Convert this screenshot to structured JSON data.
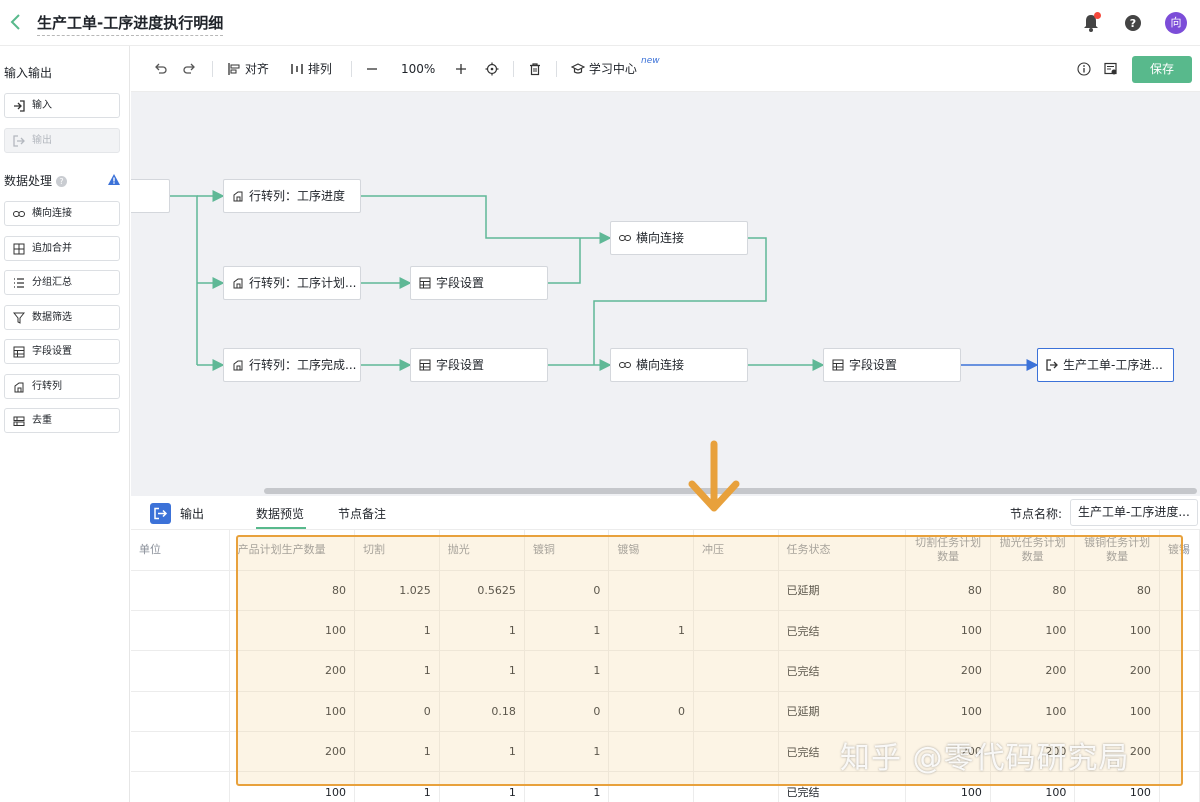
{
  "header": {
    "title": "生产工单-工序进度执行明细",
    "avatar_text": "向"
  },
  "sidebar": {
    "io_section": "输入输出",
    "io_items": [
      {
        "label": "输入",
        "icon": "input-icon"
      },
      {
        "label": "输出",
        "icon": "output-icon",
        "disabled": true
      }
    ],
    "proc_section": "数据处理",
    "proc_items": [
      {
        "label": "横向连接",
        "icon": "link-icon"
      },
      {
        "label": "追加合并",
        "icon": "merge-icon"
      },
      {
        "label": "分组汇总",
        "icon": "list-icon"
      },
      {
        "label": "数据筛选",
        "icon": "filter-icon"
      },
      {
        "label": "字段设置",
        "icon": "table-icon"
      },
      {
        "label": "行转列",
        "icon": "pivot-icon"
      },
      {
        "label": "去重",
        "icon": "dedupe-icon"
      }
    ]
  },
  "toolbar": {
    "align": "对齐",
    "arrange": "排列",
    "zoom": "100%",
    "learn": "学习中心",
    "new_badge": "new",
    "save": "保存"
  },
  "flow": {
    "nodes": {
      "n1": "行转列：工序进度",
      "n2": "行转列：工序计划...",
      "n3": "行转列：工序完成...",
      "n4": "字段设置",
      "n5": "字段设置",
      "n6": "横向连接",
      "n7": "横向连接",
      "n8": "字段设置",
      "n9": "生产工单-工序进..."
    }
  },
  "panel": {
    "output_label": "输出",
    "tabs": [
      "数据预览",
      "节点备注"
    ],
    "node_name_label": "节点名称:",
    "node_name_value": "生产工单-工序进度..."
  },
  "table": {
    "columns": [
      "单位",
      "产品计划生产数量",
      "切割",
      "抛光",
      "镀铜",
      "镀锡",
      "冲压",
      "任务状态",
      "切割任务计划数量",
      "抛光任务计划数量",
      "镀铜任务计划数量",
      "镀锡"
    ],
    "rows": [
      [
        "",
        "80",
        "1.025",
        "0.5625",
        "0",
        "",
        "",
        "已延期",
        "80",
        "80",
        "80",
        ""
      ],
      [
        "",
        "100",
        "1",
        "1",
        "1",
        "1",
        "",
        "已完结",
        "100",
        "100",
        "100",
        ""
      ],
      [
        "",
        "200",
        "1",
        "1",
        "1",
        "",
        "",
        "已完结",
        "200",
        "200",
        "200",
        ""
      ],
      [
        "",
        "100",
        "0",
        "0.18",
        "0",
        "0",
        "",
        "已延期",
        "100",
        "100",
        "100",
        ""
      ],
      [
        "",
        "200",
        "1",
        "1",
        "1",
        "",
        "",
        "已完结",
        "200",
        "200",
        "200",
        ""
      ],
      [
        "",
        "100",
        "1",
        "1",
        "1",
        "",
        "",
        "已完结",
        "100",
        "100",
        "100",
        ""
      ]
    ]
  },
  "watermark": "知乎 @零代码研究局",
  "colors": {
    "accent_green": "#58b98c",
    "link_green": "#5fb896",
    "brand_blue": "#3c72d8",
    "highlight_orange": "#e8a13c"
  }
}
